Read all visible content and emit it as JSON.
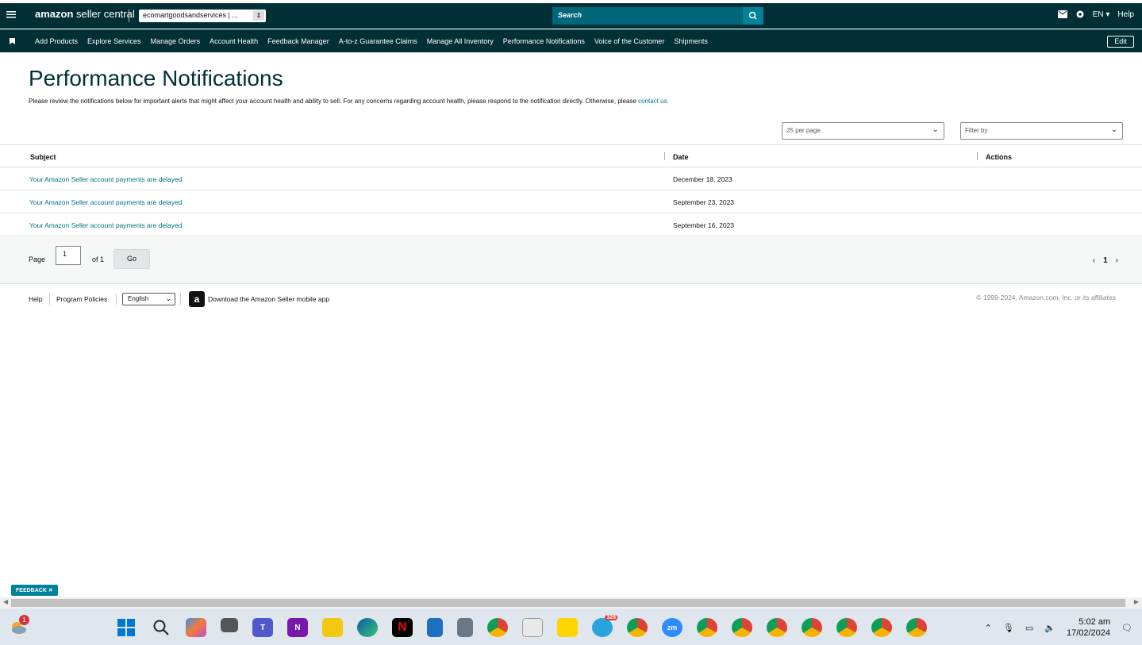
{
  "header": {
    "logo_bold": "amazon",
    "logo_text": "seller central",
    "account": "ecomartgoodsandservices | ...",
    "search_placeholder": "Search",
    "language": "EN",
    "help": "Help"
  },
  "nav": {
    "items": [
      "Add Products",
      "Explore Services",
      "Manage Orders",
      "Account Health",
      "Feedback Manager",
      "A-to-z Guarantee Claims",
      "Manage All Inventory",
      "Performance Notifications",
      "Voice of the Customer",
      "Shipments"
    ],
    "edit": "Edit"
  },
  "page": {
    "title": "Performance Notifications",
    "intro": "Please review the notifications below for important alerts that might affect your account health and ability to sell. For any concerns regarding account health, please respond to the notification directly. Otherwise, please",
    "intro_link": "contact us.",
    "per_page": "25 per page",
    "filter_placeholder": "Filter by"
  },
  "table": {
    "headers": {
      "subject": "Subject",
      "date": "Date",
      "actions": "Actions"
    },
    "rows": [
      {
        "subject": "Your Amazon Seller account payments are delayed",
        "date": "December 18, 2023"
      },
      {
        "subject": "Your Amazon Seller account payments are delayed",
        "date": "September 23, 2023"
      },
      {
        "subject": "Your Amazon Seller account payments are delayed",
        "date": "September 16, 2023"
      }
    ]
  },
  "pager": {
    "page_label": "Page",
    "page_value": "1",
    "of_label": "of 1",
    "go": "Go",
    "current": "1"
  },
  "footer": {
    "help": "Help",
    "policies": "Program Policies",
    "language": "English",
    "app": "Download the Amazon Seller mobile app",
    "copyright": "© 1999-2024, Amazon.com, Inc. or its affiliates"
  },
  "feedback": "FEEDBACK",
  "taskbar": {
    "weather_badge": "1",
    "telegram_badge": "326",
    "time": "5:02 am",
    "date": "17/02/2024"
  }
}
